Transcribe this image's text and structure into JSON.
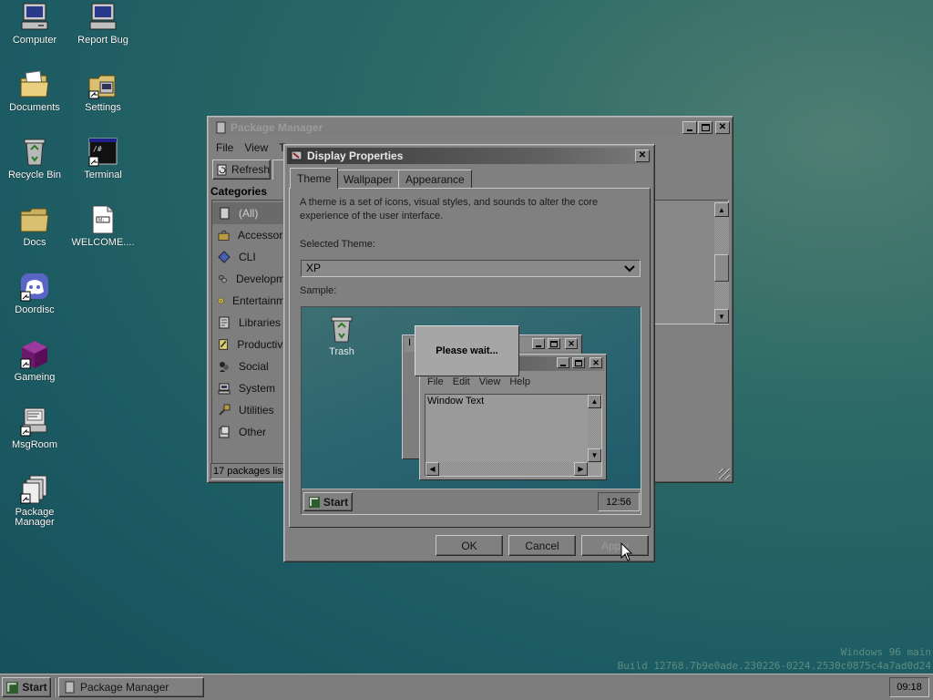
{
  "desktop": {
    "icons": [
      {
        "label": "Computer"
      },
      {
        "label": "Report Bug"
      },
      {
        "label": "Documents"
      },
      {
        "label": "Settings"
      },
      {
        "label": "Recycle Bin"
      },
      {
        "label": "Terminal"
      },
      {
        "label": "Docs"
      },
      {
        "label": "WELCOME...."
      },
      {
        "label": "Doordisc"
      },
      {
        "label": "Gameing"
      },
      {
        "label": "MsgRoom"
      },
      {
        "label": "Package Manager"
      }
    ],
    "watermark": {
      "line1": "Windows 96 main",
      "line2": "Build 12768.7b9e0ade.230226-0224.2530c0875c4a7ad0d24"
    }
  },
  "package_manager": {
    "title": "Package Manager",
    "menu": [
      "File",
      "View",
      "To"
    ],
    "toolbar": {
      "refresh_label": "Refresh"
    },
    "categories_heading": "Categories",
    "categories": [
      {
        "label": "(All)",
        "icon": "all-icon",
        "selected": true
      },
      {
        "label": "Accessori",
        "icon": "accessories-icon"
      },
      {
        "label": "CLI",
        "icon": "cli-icon"
      },
      {
        "label": "Developm",
        "icon": "development-icon"
      },
      {
        "label": "Entertainm",
        "icon": "entertainment-icon"
      },
      {
        "label": "Libraries",
        "icon": "libraries-icon"
      },
      {
        "label": "Productivi",
        "icon": "productivity-icon"
      },
      {
        "label": "Social",
        "icon": "social-icon"
      },
      {
        "label": "System",
        "icon": "system-icon"
      },
      {
        "label": "Utilities",
        "icon": "utilities-icon"
      },
      {
        "label": "Other",
        "icon": "other-icon"
      }
    ],
    "status": "17 packages liste"
  },
  "display_properties": {
    "title": "Display Properties",
    "tabs": [
      "Theme",
      "Wallpaper",
      "Appearance"
    ],
    "description": "A theme is a set of icons, visual styles, and sounds to alter the core experience of the user interface.",
    "selected_theme_label": "Selected Theme:",
    "selected_theme_value": "XP",
    "sample_label": "Sample:",
    "sample": {
      "trash_label": "Trash",
      "inactive_title_char": "I",
      "menu": [
        "File",
        "Edit",
        "View",
        "Help"
      ],
      "window_text": "Window Text",
      "start_label": "Start",
      "clock": "12:56",
      "please_wait": "Please wait..."
    },
    "buttons": {
      "ok": "OK",
      "cancel": "Cancel",
      "apply": "Apply"
    }
  },
  "taskbar": {
    "start_label": "Start",
    "tasks": [
      {
        "label": "Package Manager"
      }
    ],
    "clock": "09:18"
  }
}
